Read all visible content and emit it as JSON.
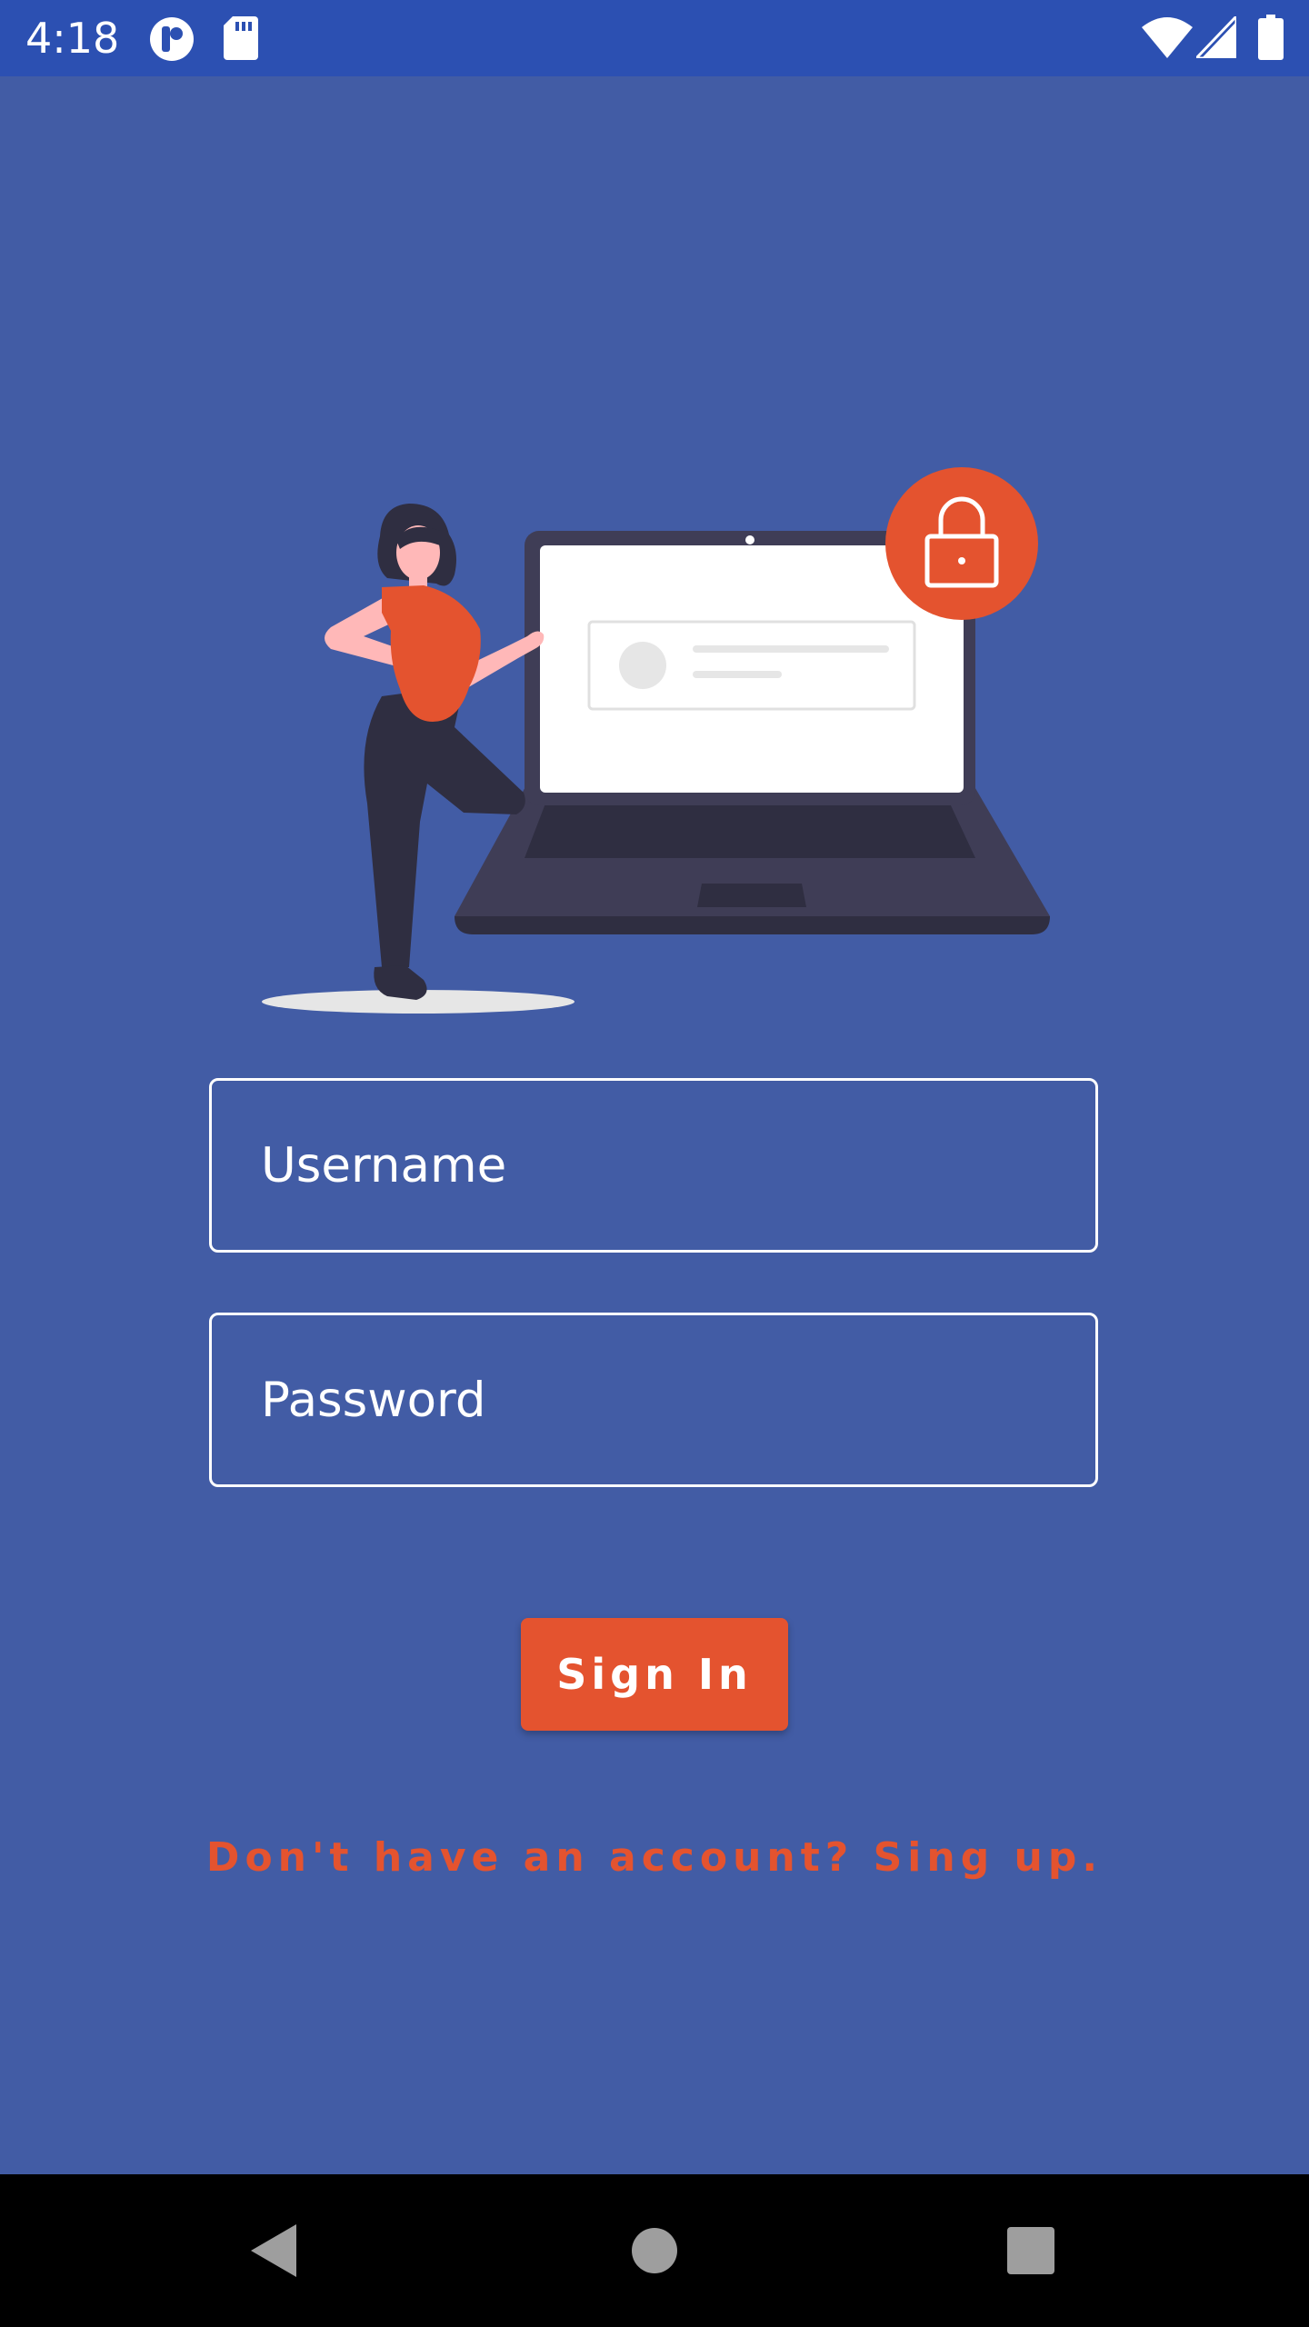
{
  "status_bar": {
    "time": "4:18",
    "icons_left": [
      "notification-app-icon",
      "sd-card-icon"
    ],
    "icons_right": [
      "wifi-icon",
      "signal-icon",
      "battery-icon"
    ],
    "background": "#2c50b2"
  },
  "screen": {
    "background": "#425ca5",
    "illustration": "person-with-laptop-lock-illustration"
  },
  "form": {
    "username_placeholder": "Username",
    "username_value": "",
    "password_placeholder": "Password",
    "password_value": "",
    "signin_label": "Sign In",
    "signup_text": "Don't have an account? Sing up.",
    "accent_color": "#e4532f"
  },
  "nav_bar": {
    "buttons": [
      "back-icon",
      "home-icon",
      "recents-icon"
    ]
  }
}
